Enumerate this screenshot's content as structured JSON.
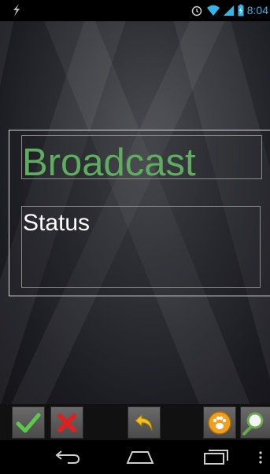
{
  "status_bar": {
    "time": "8:04",
    "icons": [
      "usb-debug-icon",
      "alarm-icon",
      "wifi-icon",
      "signal-icon",
      "battery-icon"
    ]
  },
  "form": {
    "broadcast_field": "Broadcast",
    "status_field": "Status"
  },
  "toolbar": {
    "buttons": [
      "confirm-icon",
      "cancel-icon",
      "undo-icon",
      "paw-icon",
      "search-icon"
    ]
  },
  "navbar": {
    "buttons": [
      "back-icon",
      "home-icon",
      "recent-apps-icon",
      "menu-icon"
    ]
  },
  "colors": {
    "status_accent": "#33b5e5",
    "broadcast_text": "#5fae5f",
    "status_text": "#ffffff"
  }
}
